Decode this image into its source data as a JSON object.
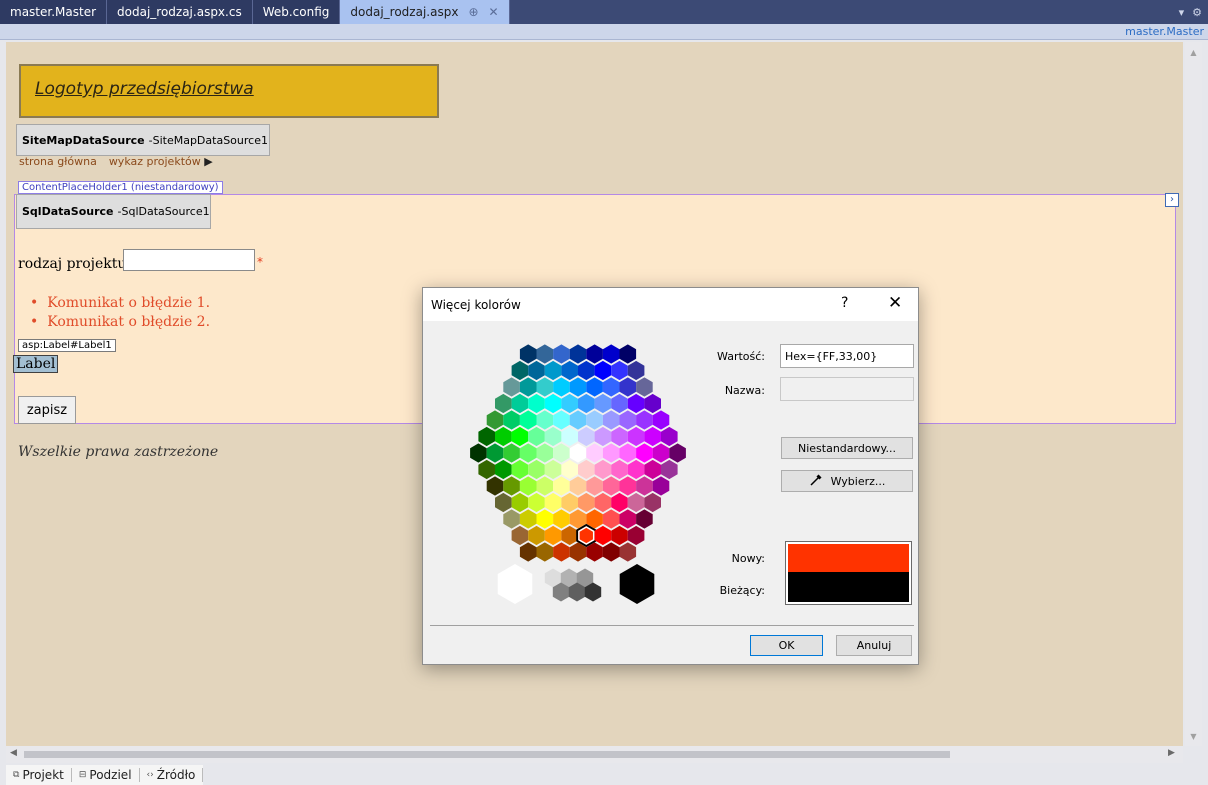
{
  "tabs": [
    {
      "label": "master.Master",
      "active": false
    },
    {
      "label": "dodaj_rodzaj.aspx.cs",
      "active": false
    },
    {
      "label": "Web.config",
      "active": false
    },
    {
      "label": "dodaj_rodzaj.aspx",
      "active": true
    }
  ],
  "doc_strip": {
    "master_name": "master.Master"
  },
  "design": {
    "logo_text": "Logotyp przedsiębiorstwa",
    "sitemap_ds": {
      "type": "SiteMapDataSource",
      "sep": " - ",
      "id": "SiteMapDataSource1"
    },
    "sitemap_items": [
      "strona główna",
      "wykaz projektów"
    ],
    "cph_label": "ContentPlaceHolder1 (niestandardowy)",
    "sql_ds": {
      "type": "SqlDataSource",
      "sep": " - ",
      "id": "SqlDataSource1"
    },
    "field_label": "rodzaj projektu:",
    "required_mark": "*",
    "errors": [
      "Komunikat o błędzie 1.",
      "Komunikat o błędzie 2."
    ],
    "label_tag": "asp:Label#Label1",
    "label_text": "Label",
    "save_label": "zapisz",
    "footer": "Wszelkie prawa zastrzeżone"
  },
  "view_tabs": [
    "Projekt",
    "Podziel",
    "Źródło"
  ],
  "dialog": {
    "title": "Więcej kolorów",
    "help": "?",
    "close": "✕",
    "value_label": "Wartość:",
    "value": "Hex={FF,33,00}",
    "name_label": "Nazwa:",
    "name_value": "",
    "custom_button": "Niestandardowy...",
    "pick_button": "Wybierz...",
    "new_label": "Nowy:",
    "current_label": "Bieżący:",
    "new_color": "#ff3300",
    "current_color": "#000000",
    "ok": "OK",
    "cancel": "Anuluj",
    "hex_rows": [
      [
        "#003366",
        "#336699",
        "#3366cc",
        "#003399",
        "#000099",
        "#0000cc",
        "#000066"
      ],
      [
        "#006666",
        "#006699",
        "#0099cc",
        "#0066cc",
        "#0033cc",
        "#0000ff",
        "#3333ff",
        "#333399"
      ],
      [
        "#669999",
        "#009999",
        "#33cccc",
        "#00ccff",
        "#0099ff",
        "#0066ff",
        "#3366ff",
        "#3333cc",
        "#666699"
      ],
      [
        "#339966",
        "#00cc99",
        "#00ffcc",
        "#00ffff",
        "#33ccff",
        "#3399ff",
        "#6699ff",
        "#6666ff",
        "#6600ff",
        "#6600cc"
      ],
      [
        "#339933",
        "#00cc66",
        "#00ff99",
        "#66ffcc",
        "#66ffff",
        "#66ccff",
        "#99ccff",
        "#9999ff",
        "#9966ff",
        "#9933ff",
        "#9900ff"
      ],
      [
        "#006600",
        "#00cc00",
        "#00ff00",
        "#66ff99",
        "#99ffcc",
        "#ccffff",
        "#ccccff",
        "#cc99ff",
        "#cc66ff",
        "#cc33ff",
        "#cc00ff",
        "#9900cc"
      ],
      [
        "#003300",
        "#009933",
        "#33cc33",
        "#66ff66",
        "#99ff99",
        "#ccffcc",
        "#ffffff",
        "#ffccff",
        "#ff99ff",
        "#ff66ff",
        "#ff00ff",
        "#cc00cc",
        "#660066"
      ],
      [
        "#336600",
        "#009900",
        "#66ff33",
        "#99ff66",
        "#ccff99",
        "#ffffcc",
        "#ffcccc",
        "#ff99cc",
        "#ff66cc",
        "#ff33cc",
        "#cc0099",
        "#993399"
      ],
      [
        "#333300",
        "#669900",
        "#99ff33",
        "#ccff66",
        "#ffff99",
        "#ffcc99",
        "#ff9999",
        "#ff6699",
        "#ff3399",
        "#cc3399",
        "#990099"
      ],
      [
        "#666633",
        "#99cc00",
        "#ccff33",
        "#ffff66",
        "#ffcc66",
        "#ff9966",
        "#ff6666",
        "#ff0066",
        "#cc6699",
        "#993366"
      ],
      [
        "#999966",
        "#cccc00",
        "#ffff00",
        "#ffcc00",
        "#ff9933",
        "#ff6600",
        "#ff5050",
        "#cc0066",
        "#660033"
      ],
      [
        "#996633",
        "#cc9900",
        "#ff9900",
        "#cc6600",
        "#ff3300",
        "#ff0000",
        "#cc0000",
        "#990033"
      ],
      [
        "#663300",
        "#996600",
        "#cc3300",
        "#993300",
        "#990000",
        "#800000",
        "#993333"
      ]
    ],
    "selected_hex": [
      11,
      4
    ],
    "gray_colors": [
      "#ffffff",
      "#dddddd",
      "#b2b2b2",
      "#969696",
      "#808080",
      "#5f5f5f",
      "#333333",
      "#000000"
    ]
  }
}
